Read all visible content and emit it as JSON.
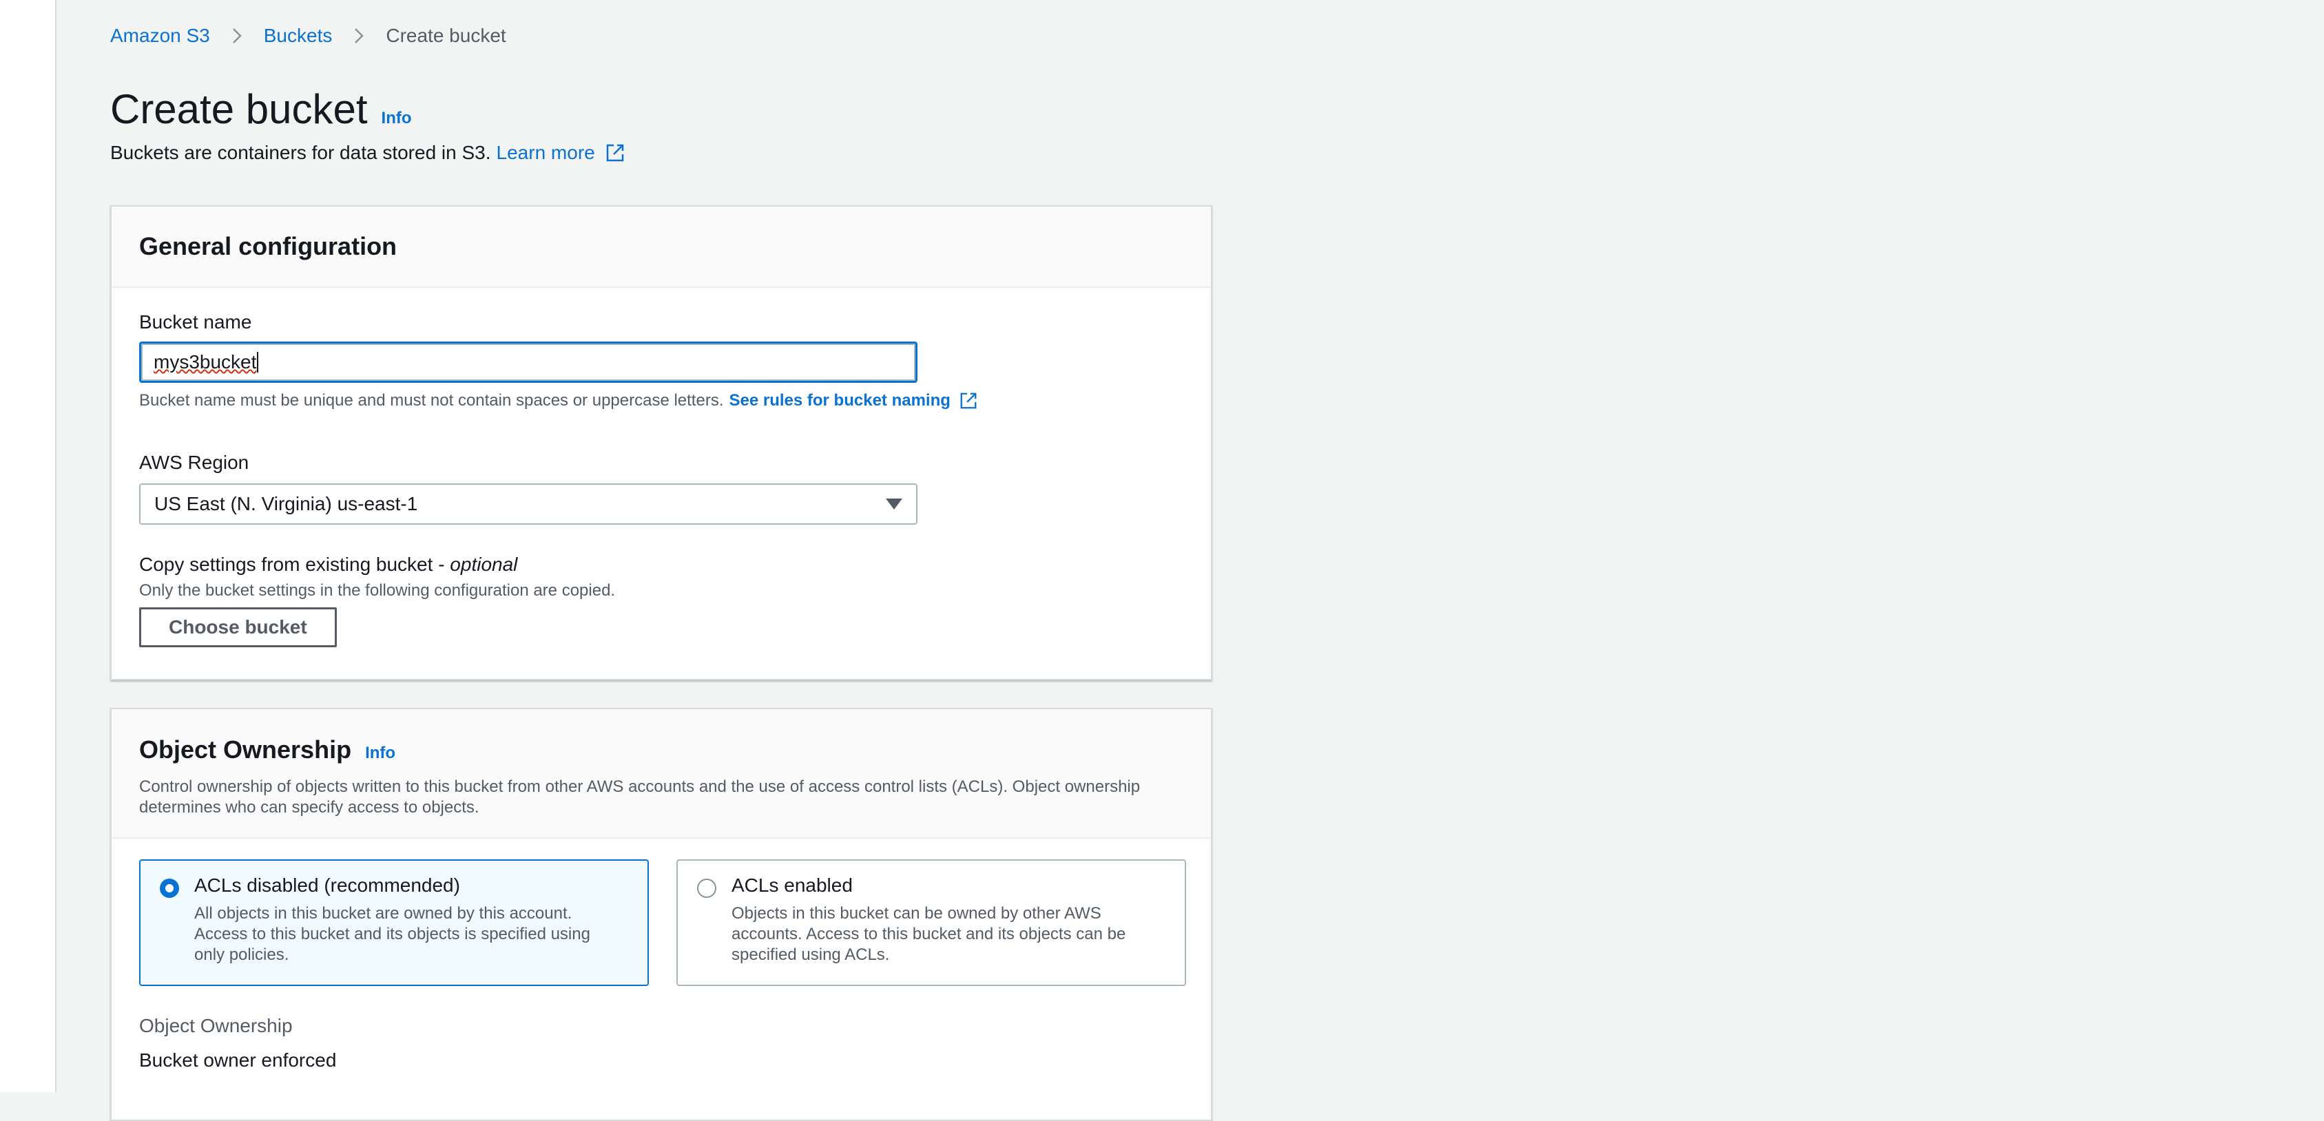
{
  "breadcrumb": {
    "items": [
      "Amazon S3",
      "Buckets"
    ],
    "current": "Create bucket"
  },
  "header": {
    "title": "Create bucket",
    "info": "Info",
    "description": "Buckets are containers for data stored in S3.",
    "learn_more": "Learn more"
  },
  "general": {
    "title": "General configuration",
    "bucket_name_label": "Bucket name",
    "bucket_name_value": "mys3bucket",
    "bucket_name_hint": "Bucket name must be unique and must not contain spaces or uppercase letters.",
    "bucket_name_rules_link": "See rules for bucket naming",
    "region_label": "AWS Region",
    "region_value": "US East (N. Virginia) us-east-1",
    "copy_label": "Copy settings from existing bucket - ",
    "copy_label_optional": "optional",
    "copy_hint": "Only the bucket settings in the following configuration are copied.",
    "choose_bucket": "Choose bucket"
  },
  "ownership": {
    "title": "Object Ownership",
    "info": "Info",
    "description": "Control ownership of objects written to this bucket from other AWS accounts and the use of access control lists (ACLs). Object ownership determines who can specify access to objects.",
    "options": [
      {
        "title": "ACLs disabled (recommended)",
        "description": "All objects in this bucket are owned by this account. Access to this bucket and its objects is specified using only policies.",
        "selected": true
      },
      {
        "title": "ACLs enabled",
        "description": "Objects in this bucket can be owned by other AWS accounts. Access to this bucket and its objects can be specified using ACLs.",
        "selected": false
      }
    ],
    "field_label": "Object Ownership",
    "field_value": "Bucket owner enforced"
  },
  "icons": {
    "breadcrumb_separator": "chevron-right-icon",
    "external_link": "external-link-icon",
    "dropdown": "caret-down-icon"
  },
  "colors": {
    "link": "#0972d3",
    "page_background": "#f2f3f3",
    "text": "#16191f",
    "secondary_text": "#545b64",
    "selected_tile_background": "#f1faff"
  }
}
